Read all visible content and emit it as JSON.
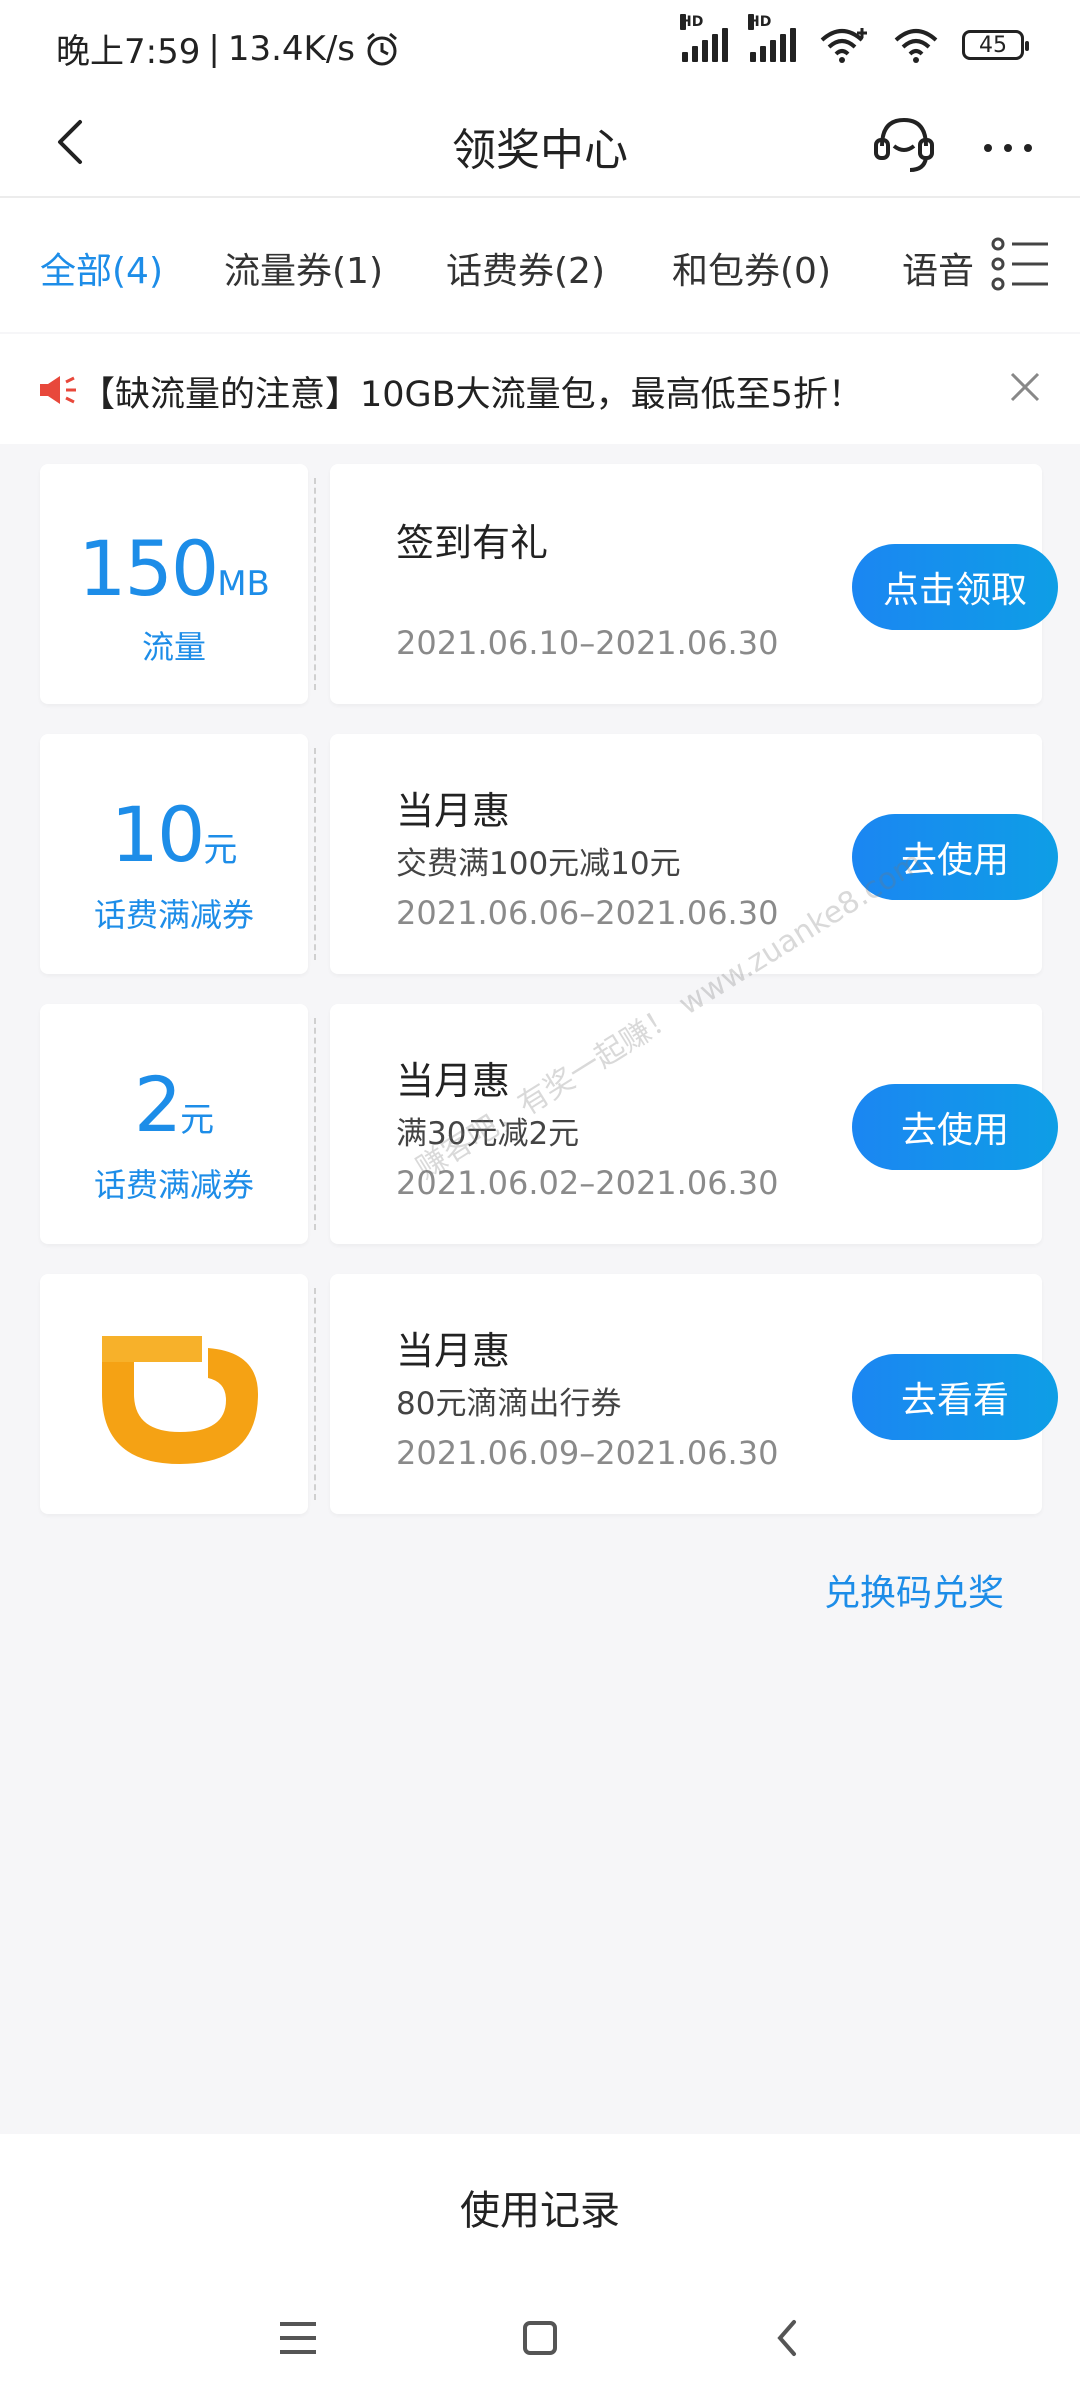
{
  "status_bar": {
    "time": "晚上7:59",
    "speed": "13.4K/s",
    "battery": "45"
  },
  "header": {
    "title": "领奖中心"
  },
  "tabs": [
    {
      "label": "全部(4)",
      "active": true
    },
    {
      "label": "流量券(1)",
      "active": false
    },
    {
      "label": "话费券(2)",
      "active": false
    },
    {
      "label": "和包券(0)",
      "active": false
    },
    {
      "label": "语音",
      "active": false
    }
  ],
  "notice": {
    "text": "【缺流量的注意】10GB大流量包，最高低至5折！"
  },
  "coupons": [
    {
      "amount": "150",
      "unit": "MB",
      "type": "流量",
      "title": "签到有礼",
      "desc": "",
      "date": "2021.06.10–2021.06.30",
      "button": "点击领取"
    },
    {
      "amount": "10",
      "unit": "元",
      "type": "话费满减券",
      "title": "当月惠",
      "desc": "交费满100元减10元",
      "date": "2021.06.06–2021.06.30",
      "button": "去使用"
    },
    {
      "amount": "2",
      "unit": "元",
      "type": "话费满减券",
      "title": "当月惠",
      "desc": "满30元减2元",
      "date": "2021.06.02–2021.06.30",
      "button": "去使用"
    },
    {
      "amount": "",
      "unit": "",
      "type": "",
      "title": "当月惠",
      "desc": "80元滴滴出行券",
      "date": "2021.06.09–2021.06.30",
      "button": "去看看",
      "logo": "didi-logo-icon"
    }
  ],
  "exchange_link": "兑换码兑奖",
  "watermark": "赚客吧，有奖一起赚！ www.zuanke8.com",
  "bottom": {
    "record_label": "使用记录"
  },
  "colors": {
    "accent": "#1d8de8",
    "didi_orange": "#f5a214"
  }
}
